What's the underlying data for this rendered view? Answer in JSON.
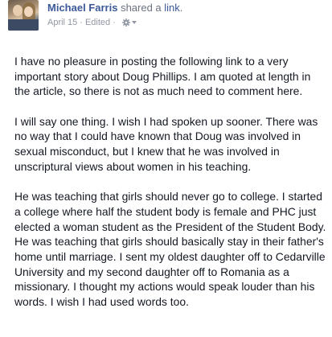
{
  "post": {
    "author": "Michael Farris",
    "action_prefix": "shared a",
    "action_link": "link",
    "action_suffix": ".",
    "date": "April 15",
    "separator": "·",
    "edited": "Edited",
    "paragraphs": [
      "I have no pleasure in posting the following link to a very important story about Doug Phillips. I am quoted at length in the article, so there is not as much need to comment here.",
      "I will say one thing. I wish I had spoken up sooner. There was no way that I could have known that Doug was involved in sexual misconduct, but I knew that he was involved in unscriptural views about women in his teaching.",
      "He was teaching that girls should never go to college. I started a college where half the student body is female and PHC just elected a woman student as the President of the Student Body. He was teaching that girls should basically stay in their father's home until marriage. I sent my oldest daughter off to Cedarville University and my second daughter off to Romania as a missionary. I thought my actions would speak louder than his words. I wish I had used words too."
    ]
  },
  "colors": {
    "author": "#3b5998",
    "text": "#141823",
    "meta": "#9197a3"
  },
  "icons": {
    "privacy": "gear-icon",
    "menu": "caret-down-icon",
    "avatar": "profile-photo"
  }
}
